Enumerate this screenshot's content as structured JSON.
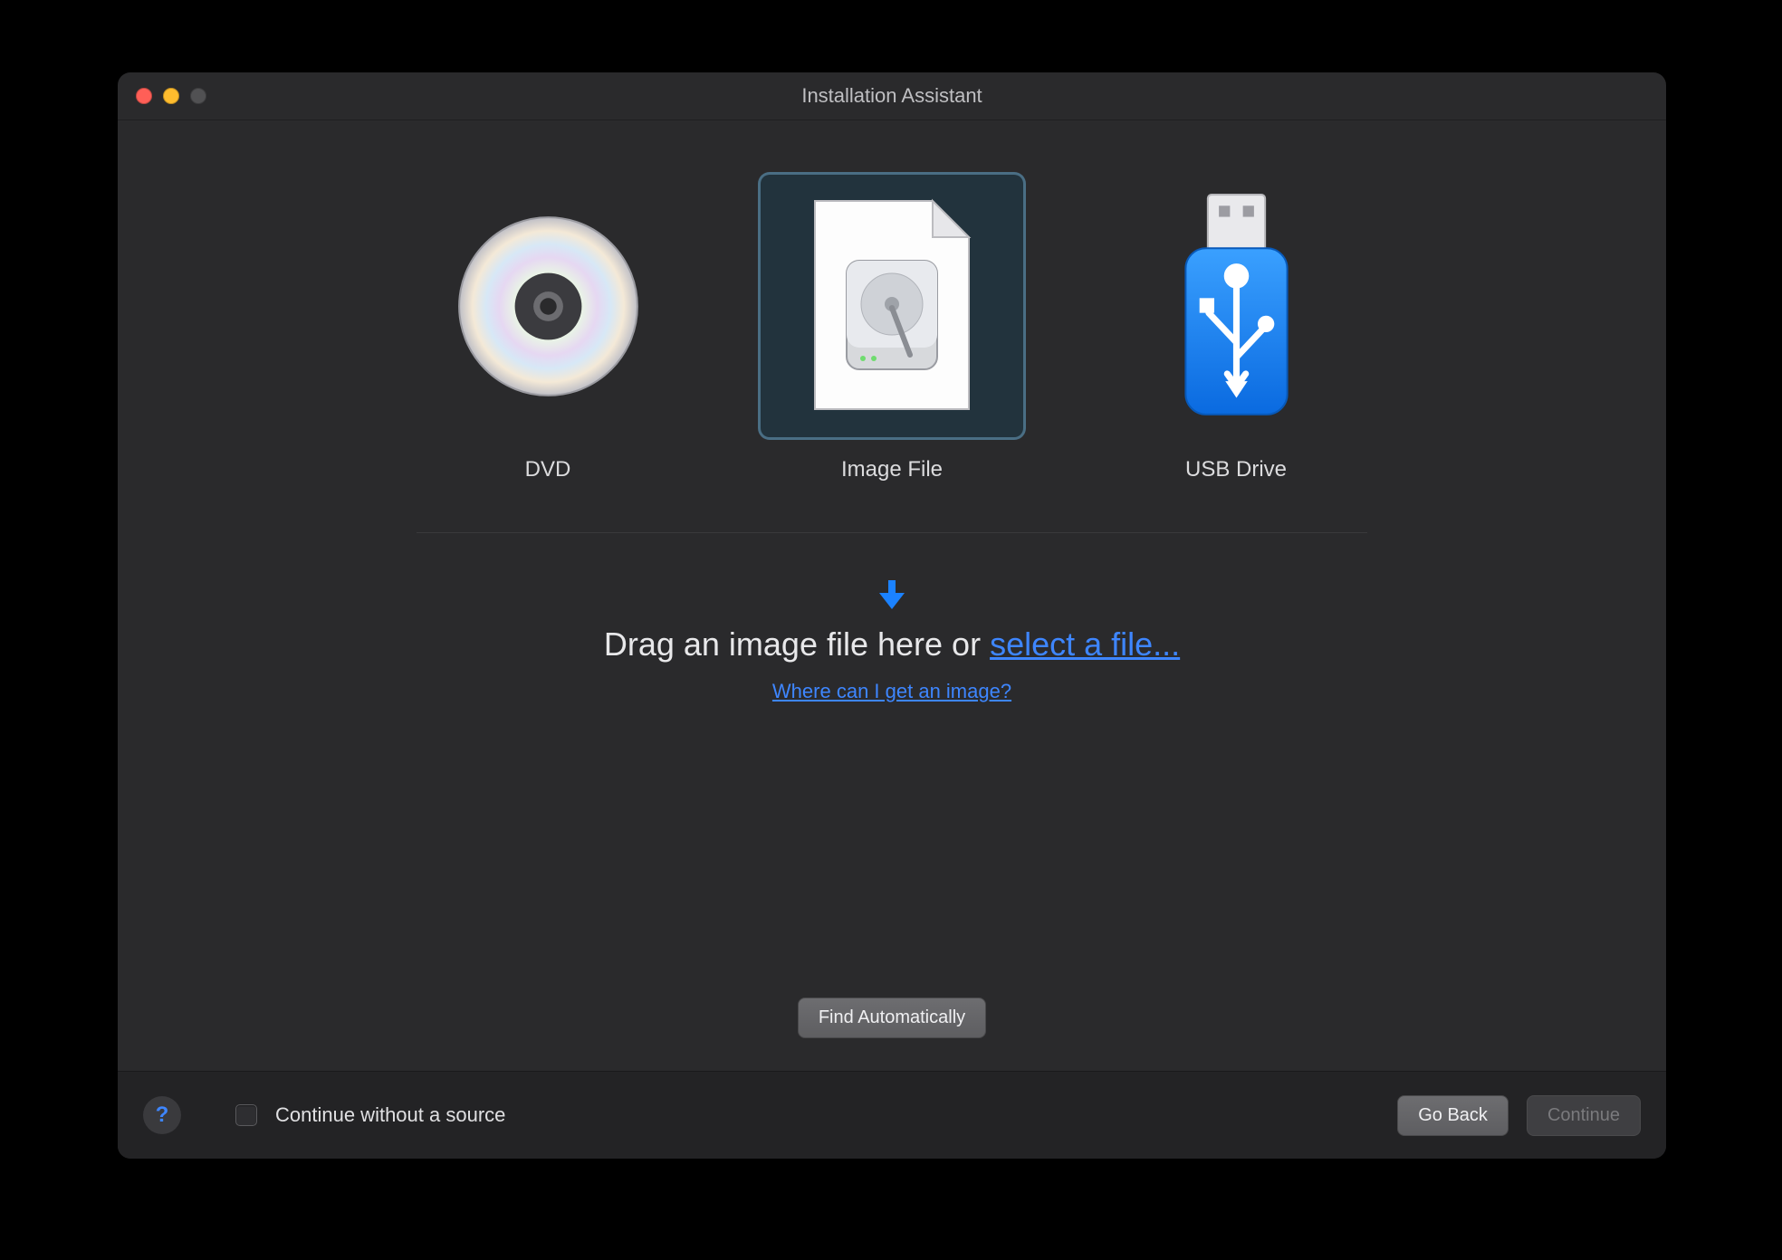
{
  "window": {
    "title": "Installation Assistant"
  },
  "options": {
    "dvd": {
      "label": "DVD"
    },
    "image": {
      "label": "Image File",
      "selected": true
    },
    "usb": {
      "label": "USB Drive"
    }
  },
  "drop": {
    "prefix": "Drag an image file here or ",
    "link": "select a file...",
    "help_link": "Where can I get an image?"
  },
  "buttons": {
    "find_auto": "Find Automatically",
    "go_back": "Go Back",
    "continue": "Continue"
  },
  "footer": {
    "continue_without": "Continue without a source"
  },
  "colors": {
    "accent": "#3e86ff"
  }
}
